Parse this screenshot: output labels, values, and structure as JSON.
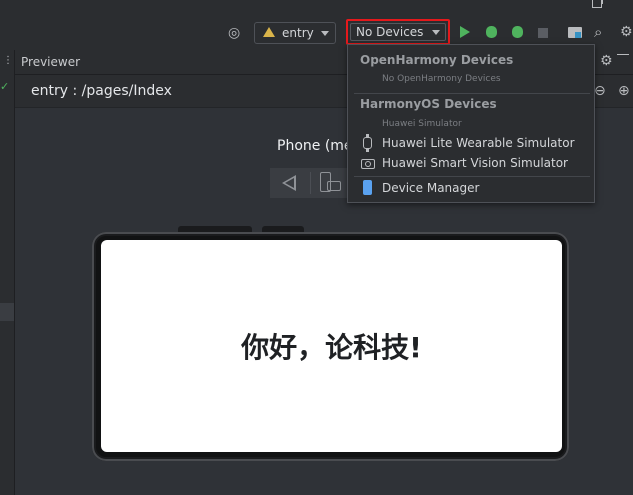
{
  "toolbar": {
    "module_select": "entry",
    "device_select": "No Devices"
  },
  "previewer": {
    "title": "Previewer",
    "path": "entry : /pages/Index",
    "device_label": "Phone (me",
    "screen_text": "你好，论科技!"
  },
  "device_dropdown": {
    "openharmony_header": "OpenHarmony Devices",
    "openharmony_empty": "No OpenHarmony Devices",
    "harmonyos_header": "HarmonyOS Devices",
    "harmonyos_sub": "Huawei Simulator",
    "items": [
      "Huawei Lite Wearable Simulator",
      "Huawei Smart Vision Simulator"
    ],
    "device_manager": "Device Manager"
  },
  "colors": {
    "highlight": "#e5191c",
    "run_green": "#4fb35e",
    "background": "#2b2d30"
  }
}
